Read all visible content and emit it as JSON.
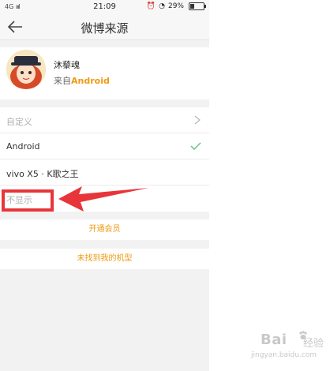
{
  "status_bar": {
    "network": "4G",
    "time": "21:09",
    "battery": "29%"
  },
  "header": {
    "title": "微博来源"
  },
  "profile": {
    "name": "沐藜魂",
    "source_prefix": "来自",
    "source_brand": "Android"
  },
  "list": {
    "items": [
      {
        "label": "自定义",
        "muted": true,
        "trailing": "chevron"
      },
      {
        "label": "Android",
        "muted": false,
        "trailing": "check"
      },
      {
        "label": "vivo X5 · K歌之王",
        "muted": false,
        "trailing": ""
      },
      {
        "label": "不显示",
        "muted": true,
        "trailing": ""
      }
    ]
  },
  "actions": {
    "member": "开通会员",
    "not_found": "未找到我的机型"
  },
  "watermark": {
    "logo": "Bai",
    "logo_suffix": "经验",
    "url": "jingyan.baidu.com"
  },
  "colors": {
    "accent": "#f09a12",
    "annotation_red": "#e8353a",
    "check_green": "#5bc279"
  }
}
